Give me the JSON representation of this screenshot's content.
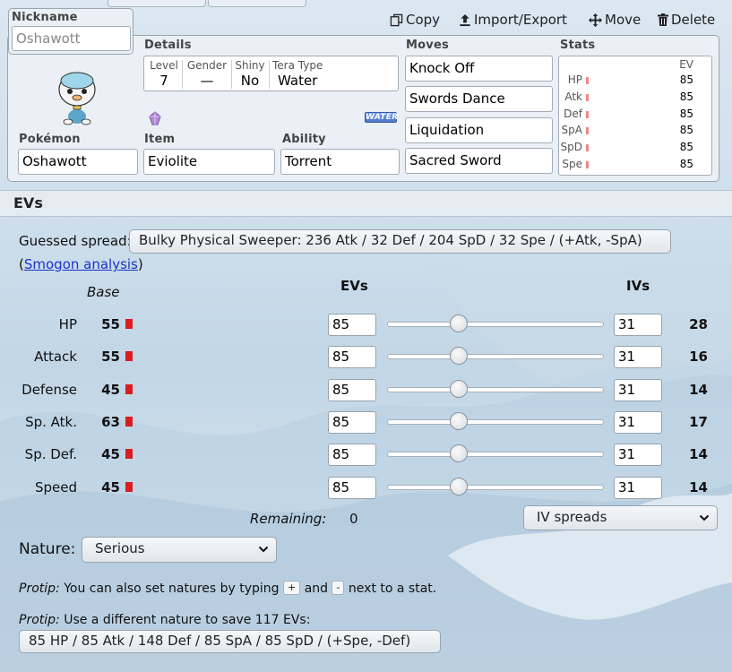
{
  "toolbar": {
    "copy_label": "Copy",
    "import_export_label": "Import/Export",
    "move_label": "Move",
    "delete_label": "Delete"
  },
  "nickname": {
    "label": "Nickname",
    "placeholder": "Oshawott"
  },
  "details": {
    "label": "Details",
    "level_label": "Level",
    "level": "7",
    "gender_label": "Gender",
    "gender": "—",
    "shiny_label": "Shiny",
    "shiny": "No",
    "tera_label": "Tera Type",
    "tera": "Water"
  },
  "pokemon": {
    "label": "Pokémon",
    "value": "Oshawott",
    "type_badge": "WATER"
  },
  "item": {
    "label": "Item",
    "value": "Eviolite"
  },
  "ability": {
    "label": "Ability",
    "value": "Torrent"
  },
  "moves": {
    "label": "Moves",
    "list": [
      "Knock Off",
      "Swords Dance",
      "Liquidation",
      "Sacred Sword"
    ]
  },
  "stats_panel": {
    "label": "Stats",
    "ev_header": "EV",
    "rows": [
      {
        "name": "HP",
        "ev": "85"
      },
      {
        "name": "Atk",
        "ev": "85"
      },
      {
        "name": "Def",
        "ev": "85"
      },
      {
        "name": "SpA",
        "ev": "85"
      },
      {
        "name": "SpD",
        "ev": "85"
      },
      {
        "name": "Spe",
        "ev": "85"
      }
    ]
  },
  "evs_section": {
    "title": "EVs",
    "guessed_label": "Guessed spread:",
    "guessed_value": "Bulky Physical Sweeper: 236 Atk / 32 Def / 204 SpD / 32 Spe / (+Atk, -SpA)",
    "smogon_open": "(",
    "smogon_link": "Smogon analysis",
    "smogon_close": ")",
    "base_header": "Base",
    "evs_header": "EVs",
    "ivs_header": "IVs",
    "rows": [
      {
        "name": "HP",
        "base": "55",
        "ev": "85",
        "iv": "31",
        "total": "28",
        "ev_fraction": 0.333
      },
      {
        "name": "Attack",
        "base": "55",
        "ev": "85",
        "iv": "31",
        "total": "16",
        "ev_fraction": 0.333
      },
      {
        "name": "Defense",
        "base": "45",
        "ev": "85",
        "iv": "31",
        "total": "14",
        "ev_fraction": 0.333
      },
      {
        "name": "Sp. Atk.",
        "base": "63",
        "ev": "85",
        "iv": "31",
        "total": "17",
        "ev_fraction": 0.333
      },
      {
        "name": "Sp. Def.",
        "base": "45",
        "ev": "85",
        "iv": "31",
        "total": "14",
        "ev_fraction": 0.333
      },
      {
        "name": "Speed",
        "base": "45",
        "ev": "85",
        "iv": "31",
        "total": "14",
        "ev_fraction": 0.333
      }
    ],
    "remaining_label": "Remaining:",
    "remaining_value": "0",
    "iv_spreads_label": "IV spreads",
    "nature_label": "Nature:",
    "nature_value": "Serious",
    "protip1_label": "Protip:",
    "protip1_text_a": "You can also set natures by typing",
    "protip1_plus": "+",
    "protip1_and": "and",
    "protip1_minus": "-",
    "protip1_text_b": "next to a stat.",
    "protip2_label": "Protip:",
    "protip2_text": "Use a different nature to save 117 EVs:",
    "protip2_button": "85 HP / 85 Atk / 148 Def / 85 SpA / 85 SpD / (+Spe, -Def)"
  },
  "colors": {
    "panel_bg": "#eaf0f5",
    "base_bar": "#d81e1e",
    "link": "#1a33c8",
    "type_water": "#5b82d6"
  }
}
